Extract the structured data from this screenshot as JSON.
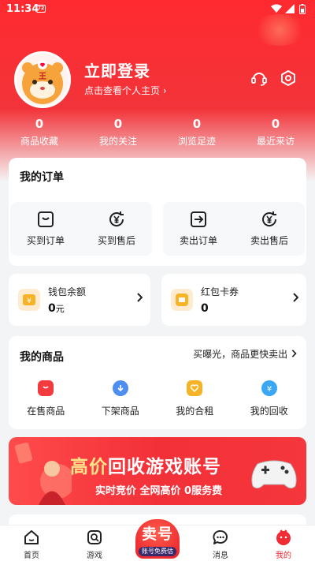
{
  "status_bar": {
    "time": "11:34",
    "chip": "72"
  },
  "profile": {
    "title": "立即登录",
    "subtitle": "点击查看个人主页",
    "chevron": "›",
    "avatar_badge": "王"
  },
  "stats": [
    {
      "value": "0",
      "label": "商品收藏"
    },
    {
      "value": "0",
      "label": "我的关注"
    },
    {
      "value": "0",
      "label": "浏览足迹"
    },
    {
      "value": "0",
      "label": "最近来访"
    }
  ],
  "orders": {
    "title": "我的订单",
    "buy": [
      {
        "label": "买到订单",
        "icon": "box-icon"
      },
      {
        "label": "买到售后",
        "icon": "yen-refund-icon"
      }
    ],
    "sell": [
      {
        "label": "卖出订单",
        "icon": "arrow-box-icon"
      },
      {
        "label": "卖出售后",
        "icon": "yen-refund-icon"
      }
    ]
  },
  "wallet": {
    "label": "钱包余额",
    "value": "0",
    "unit": "元"
  },
  "coupon": {
    "label": "红包卡券",
    "value": "0"
  },
  "goods": {
    "title": "我的商品",
    "link": "买曝光，商品更快卖出",
    "items": [
      {
        "label": "在售商品",
        "color": "#f23a3f"
      },
      {
        "label": "下架商品",
        "color": "#4d8ef0"
      },
      {
        "label": "我的合租",
        "color": "#f5b325"
      },
      {
        "label": "我的回收",
        "color": "#3aa7f5"
      }
    ]
  },
  "banner": {
    "title_a": "高价",
    "title_b": "回收游戏账号",
    "subtitle": "实时竞价  全网高价  0服务费"
  },
  "tabs": [
    {
      "label": "首页"
    },
    {
      "label": "游戏"
    },
    {
      "label": "消息"
    },
    {
      "label": "我的",
      "active": true
    }
  ],
  "sell_button": {
    "label": "卖号",
    "tag": "账号免费估"
  },
  "colors": {
    "primary": "#f02b33",
    "accent": "#ffe38a"
  }
}
